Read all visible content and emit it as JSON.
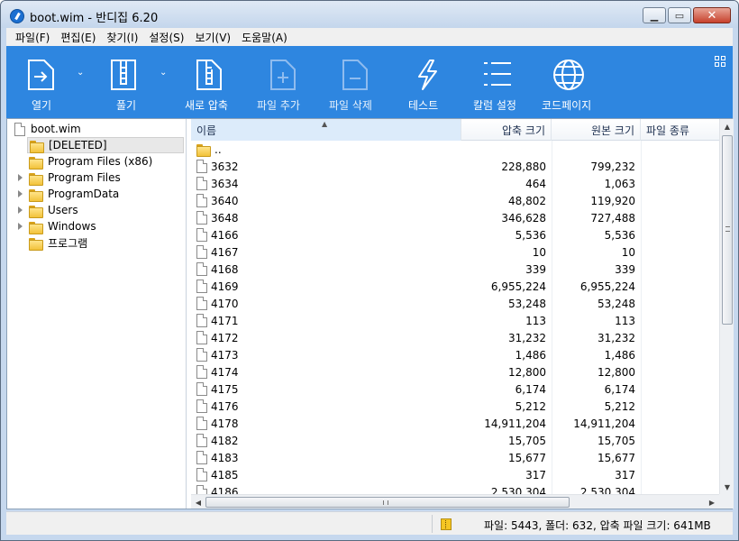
{
  "window": {
    "title": "boot.wim - 반디집 6.20"
  },
  "menu": [
    "파일(F)",
    "편집(E)",
    "찾기(I)",
    "설정(S)",
    "보기(V)",
    "도움말(A)"
  ],
  "toolbar": {
    "open": "열기",
    "extract": "풀기",
    "new_archive": "새로 압축",
    "add_file": "파일 추가",
    "delete_file": "파일 삭제",
    "test": "테스트",
    "column_settings": "칼럼 설정",
    "codepage": "코드페이지"
  },
  "tree": {
    "root": "boot.wim",
    "items": [
      {
        "label": "[DELETED]",
        "expandable": false,
        "selected": true
      },
      {
        "label": "Program Files (x86)",
        "expandable": false,
        "selected": false
      },
      {
        "label": "Program Files",
        "expandable": true,
        "selected": false
      },
      {
        "label": "ProgramData",
        "expandable": true,
        "selected": false
      },
      {
        "label": "Users",
        "expandable": true,
        "selected": false
      },
      {
        "label": "Windows",
        "expandable": true,
        "selected": false
      },
      {
        "label": "프로그램",
        "expandable": false,
        "selected": false
      }
    ]
  },
  "list": {
    "columns": {
      "name": "이름",
      "packed": "압축 크기",
      "original": "원본 크기",
      "type": "파일 종류"
    },
    "rows": [
      {
        "name": "..",
        "packed": "",
        "original": "",
        "folder": true
      },
      {
        "name": "3632",
        "packed": "228,880",
        "original": "799,232"
      },
      {
        "name": "3634",
        "packed": "464",
        "original": "1,063"
      },
      {
        "name": "3640",
        "packed": "48,802",
        "original": "119,920"
      },
      {
        "name": "3648",
        "packed": "346,628",
        "original": "727,488"
      },
      {
        "name": "4166",
        "packed": "5,536",
        "original": "5,536"
      },
      {
        "name": "4167",
        "packed": "10",
        "original": "10"
      },
      {
        "name": "4168",
        "packed": "339",
        "original": "339"
      },
      {
        "name": "4169",
        "packed": "6,955,224",
        "original": "6,955,224"
      },
      {
        "name": "4170",
        "packed": "53,248",
        "original": "53,248"
      },
      {
        "name": "4171",
        "packed": "113",
        "original": "113"
      },
      {
        "name": "4172",
        "packed": "31,232",
        "original": "31,232"
      },
      {
        "name": "4173",
        "packed": "1,486",
        "original": "1,486"
      },
      {
        "name": "4174",
        "packed": "12,800",
        "original": "12,800"
      },
      {
        "name": "4175",
        "packed": "6,174",
        "original": "6,174"
      },
      {
        "name": "4176",
        "packed": "5,212",
        "original": "5,212"
      },
      {
        "name": "4178",
        "packed": "14,911,204",
        "original": "14,911,204"
      },
      {
        "name": "4182",
        "packed": "15,705",
        "original": "15,705"
      },
      {
        "name": "4183",
        "packed": "15,677",
        "original": "15,677"
      },
      {
        "name": "4185",
        "packed": "317",
        "original": "317"
      },
      {
        "name": "4186",
        "packed": "2,530,304",
        "original": "2,530,304"
      }
    ]
  },
  "status": {
    "text": "파일: 5443, 폴더: 632, 압축 파일 크기: 641MB"
  },
  "colors": {
    "toolbar_bg": "#2e86e0",
    "header_selected": "#dcebfa"
  }
}
